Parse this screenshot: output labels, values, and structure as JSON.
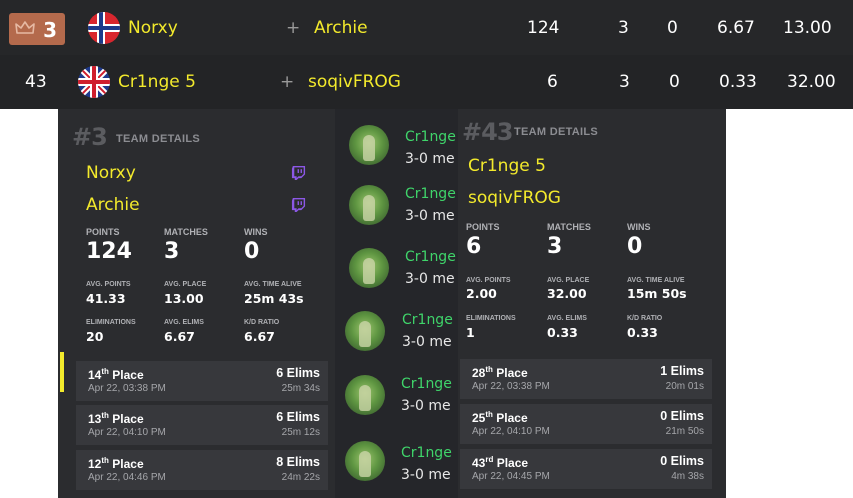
{
  "rows": [
    {
      "rank": "3",
      "player1": "Norxy",
      "player2": "Archie",
      "points": "124",
      "matches": "3",
      "wins": "0",
      "avg_place_ratio": "6.67",
      "avg_place": "13.00",
      "flag": "norway-flag"
    },
    {
      "rank": "43",
      "player1": "Cr1nge 5",
      "player2": "soqivFROG",
      "points": "6",
      "matches": "3",
      "wins": "0",
      "avg_place_ratio": "0.33",
      "avg_place": "32.00",
      "flag": "uk-flag"
    }
  ],
  "plus_sign": "+",
  "left_panel": {
    "hash": "#3",
    "label": "TEAM DETAILS",
    "players": [
      "Norxy",
      "Archie"
    ],
    "big_stats": [
      {
        "label": "POINTS",
        "value": "124"
      },
      {
        "label": "MATCHES",
        "value": "3"
      },
      {
        "label": "WINS",
        "value": "0"
      }
    ],
    "small_stats_1": [
      {
        "label": "AVG. POINTS",
        "value": "41.33"
      },
      {
        "label": "AVG. PLACE",
        "value": "13.00"
      },
      {
        "label": "AVG. TIME ALIVE",
        "value": "25m 43s"
      }
    ],
    "small_stats_2": [
      {
        "label": "ELIMINATIONS",
        "value": "20"
      },
      {
        "label": "AVG. ELIMS",
        "value": "6.67"
      },
      {
        "label": "K/D RATIO",
        "value": "6.67"
      }
    ],
    "matches": [
      {
        "place": "14",
        "suffix": "th",
        "place_word": "Place",
        "date": "Apr 22, 03:38 PM",
        "elims": "6 Elims",
        "time": "25m 34s"
      },
      {
        "place": "13",
        "suffix": "th",
        "place_word": "Place",
        "date": "Apr 22, 04:10 PM",
        "elims": "6 Elims",
        "time": "25m 12s"
      },
      {
        "place": "12",
        "suffix": "th",
        "place_word": "Place",
        "date": "Apr 22, 04:46 PM",
        "elims": "8 Elims",
        "time": "24m 22s"
      }
    ]
  },
  "right_panel": {
    "hash": "#43",
    "label": "TEAM DETAILS",
    "players": [
      "Cr1nge 5",
      "soqivFROG"
    ],
    "big_stats": [
      {
        "label": "POINTS",
        "value": "6"
      },
      {
        "label": "MATCHES",
        "value": "3"
      },
      {
        "label": "WINS",
        "value": "0"
      }
    ],
    "small_stats_1": [
      {
        "label": "AVG. POINTS",
        "value": "2.00"
      },
      {
        "label": "AVG. PLACE",
        "value": "32.00"
      },
      {
        "label": "AVG. TIME ALIVE",
        "value": "15m 50s"
      }
    ],
    "small_stats_2": [
      {
        "label": "ELIMINATIONS",
        "value": "1"
      },
      {
        "label": "AVG. ELIMS",
        "value": "0.33"
      },
      {
        "label": "K/D RATIO",
        "value": "0.33"
      }
    ],
    "matches": [
      {
        "place": "28",
        "suffix": "th",
        "place_word": "Place",
        "date": "Apr 22, 03:38 PM",
        "elims": "1 Elims",
        "time": "20m 01s"
      },
      {
        "place": "25",
        "suffix": "th",
        "place_word": "Place",
        "date": "Apr 22, 04:10 PM",
        "elims": "0 Elims",
        "time": "21m 50s"
      },
      {
        "place": "43",
        "suffix": "rd",
        "place_word": "Place",
        "date": "Apr 22, 04:45 PM",
        "elims": "0 Elims",
        "time": "4m 38s"
      }
    ]
  },
  "mid_list": [
    {
      "name": "Cr1nge",
      "score": "3-0 me"
    },
    {
      "name": "Cr1nge",
      "score": "3-0 me"
    },
    {
      "name": "Cr1nge",
      "score": "3-0 me"
    },
    {
      "name": "Cr1nge",
      "score": "3-0 me"
    },
    {
      "name": "Cr1nge",
      "score": "3-0 me"
    },
    {
      "name": "Cr1nge",
      "score": "3-0 me"
    }
  ],
  "colors": {
    "accent_yellow": "#f3ea2c",
    "rank_badge": "#b46a4c",
    "mid_name": "#3fd46a",
    "panel_bg": "#2b2c2f"
  }
}
